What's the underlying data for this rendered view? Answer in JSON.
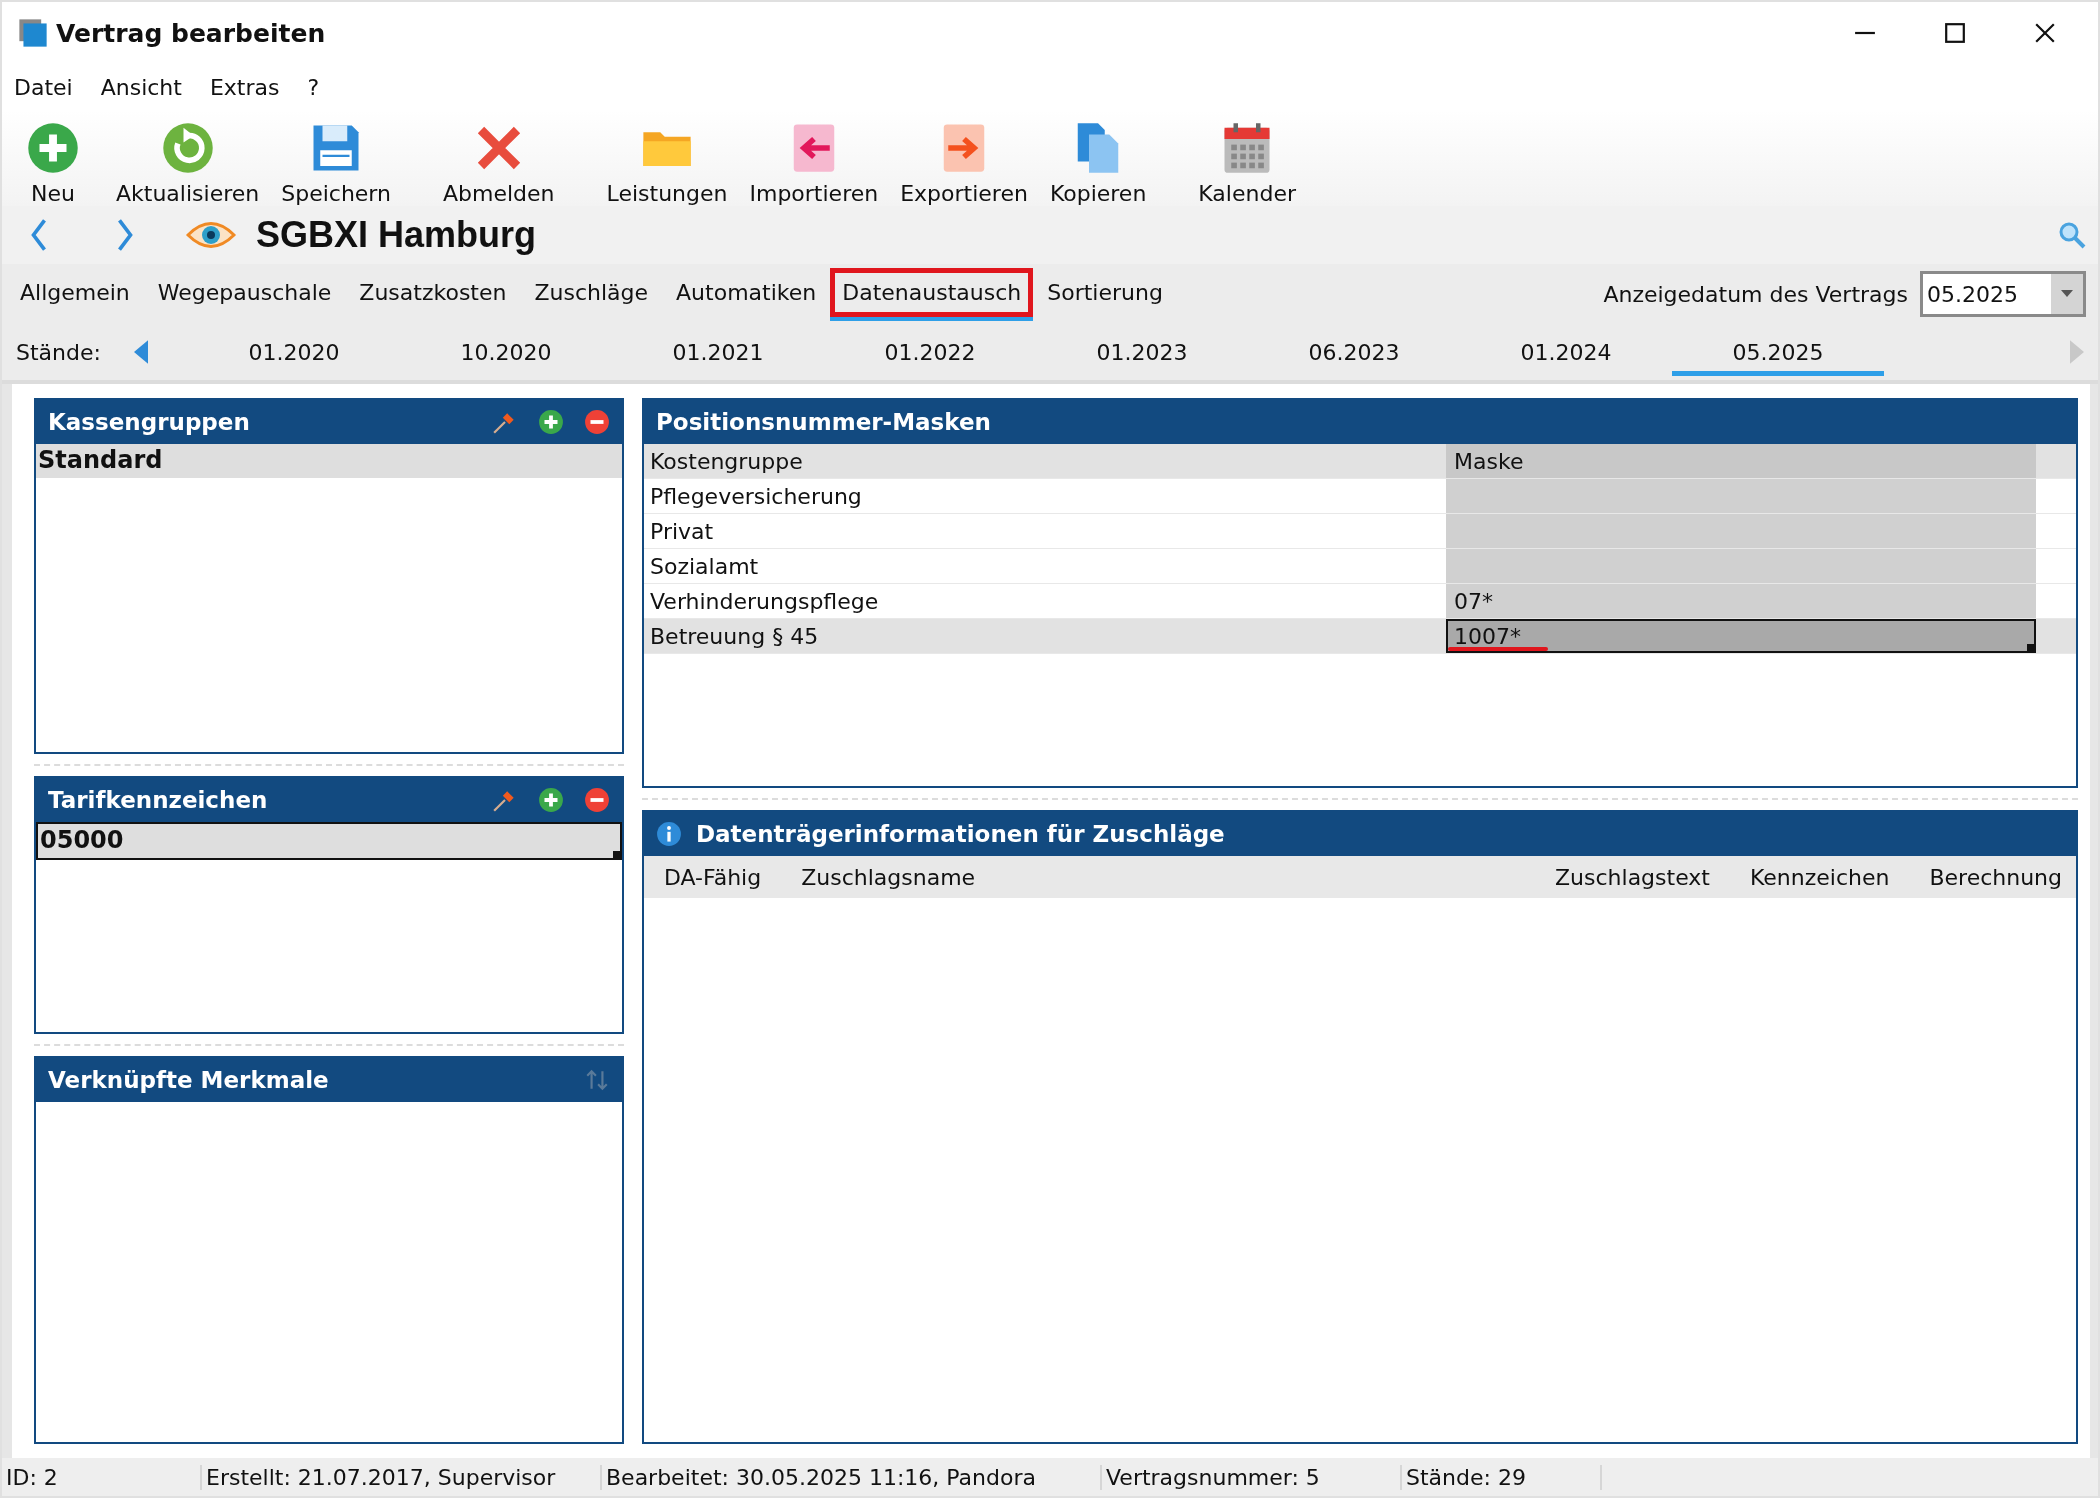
{
  "window": {
    "title": "Vertrag bearbeiten"
  },
  "menu": [
    "Datei",
    "Ansicht",
    "Extras",
    "?"
  ],
  "toolbar": [
    {
      "kind": "new",
      "label": "Neu"
    },
    {
      "kind": "refresh",
      "label": "Aktualisieren"
    },
    {
      "kind": "save",
      "label": "Speichern"
    },
    {
      "kind": "logout",
      "label": "Abmelden"
    },
    {
      "kind": "folder",
      "label": "Leistungen"
    },
    {
      "kind": "import",
      "label": "Importieren"
    },
    {
      "kind": "export",
      "label": "Exportieren"
    },
    {
      "kind": "copy",
      "label": "Kopieren"
    },
    {
      "kind": "calendar",
      "label": "Kalender"
    }
  ],
  "heading": "SGBXI Hamburg",
  "tabs": [
    {
      "label": "Allgemein",
      "selected": false,
      "annotated": false
    },
    {
      "label": "Wegepauschale",
      "selected": false,
      "annotated": false
    },
    {
      "label": "Zusatzkosten",
      "selected": false,
      "annotated": false
    },
    {
      "label": "Zuschläge",
      "selected": false,
      "annotated": false
    },
    {
      "label": "Automatiken",
      "selected": false,
      "annotated": false
    },
    {
      "label": "Datenaustausch",
      "selected": true,
      "annotated": true
    },
    {
      "label": "Sortierung",
      "selected": false,
      "annotated": false
    }
  ],
  "display_date": {
    "label": "Anzeigedatum des Vertrags",
    "value": "05.2025"
  },
  "versions": {
    "label": "Stände:",
    "items": [
      {
        "label": "01.2020",
        "selected": false
      },
      {
        "label": "10.2020",
        "selected": false
      },
      {
        "label": "01.2021",
        "selected": false
      },
      {
        "label": "01.2022",
        "selected": false
      },
      {
        "label": "01.2023",
        "selected": false
      },
      {
        "label": "06.2023",
        "selected": false
      },
      {
        "label": "01.2024",
        "selected": false
      },
      {
        "label": "05.2025",
        "selected": true
      }
    ]
  },
  "left_panels": [
    {
      "kind": "editable",
      "title": "Kassengruppen",
      "items": [
        {
          "label": "Standard",
          "selected": true,
          "focused": false
        }
      ]
    },
    {
      "kind": "editable",
      "title": "Tarifkennzeichen",
      "items": [
        {
          "label": "05000",
          "selected": true,
          "focused": true
        }
      ]
    },
    {
      "kind": "sortable",
      "title": "Verknüpfte Merkmale"
    }
  ],
  "masks": {
    "title": "Positionsnummer-Masken",
    "columns": [
      "Kostengruppe",
      "Maske"
    ],
    "rows": [
      {
        "group": "Pflegeversicherung",
        "mask": "",
        "selected": false,
        "annotated": false
      },
      {
        "group": "Privat",
        "mask": "",
        "selected": false,
        "annotated": false
      },
      {
        "group": "Sozialamt",
        "mask": "",
        "selected": false,
        "annotated": false
      },
      {
        "group": "Verhinderungspflege",
        "mask": "07*",
        "selected": false,
        "annotated": false
      },
      {
        "group": "Betreuung § 45",
        "mask": "1007*",
        "selected": true,
        "annotated": true
      }
    ]
  },
  "surcharges": {
    "title": "Datenträgerinformationen für Zuschläge",
    "columns": [
      "DA-Fähig",
      "Zuschlagsname",
      "Zuschlagstext",
      "Kennzeichen",
      "Berechnung"
    ]
  },
  "status_bar": [
    "ID: 2",
    "Erstellt: 21.07.2017, Supervisor",
    "Bearbeitet: 30.05.2025 11:16, Pandora",
    "Vertragsnummer: 5",
    "Stände: 29"
  ]
}
